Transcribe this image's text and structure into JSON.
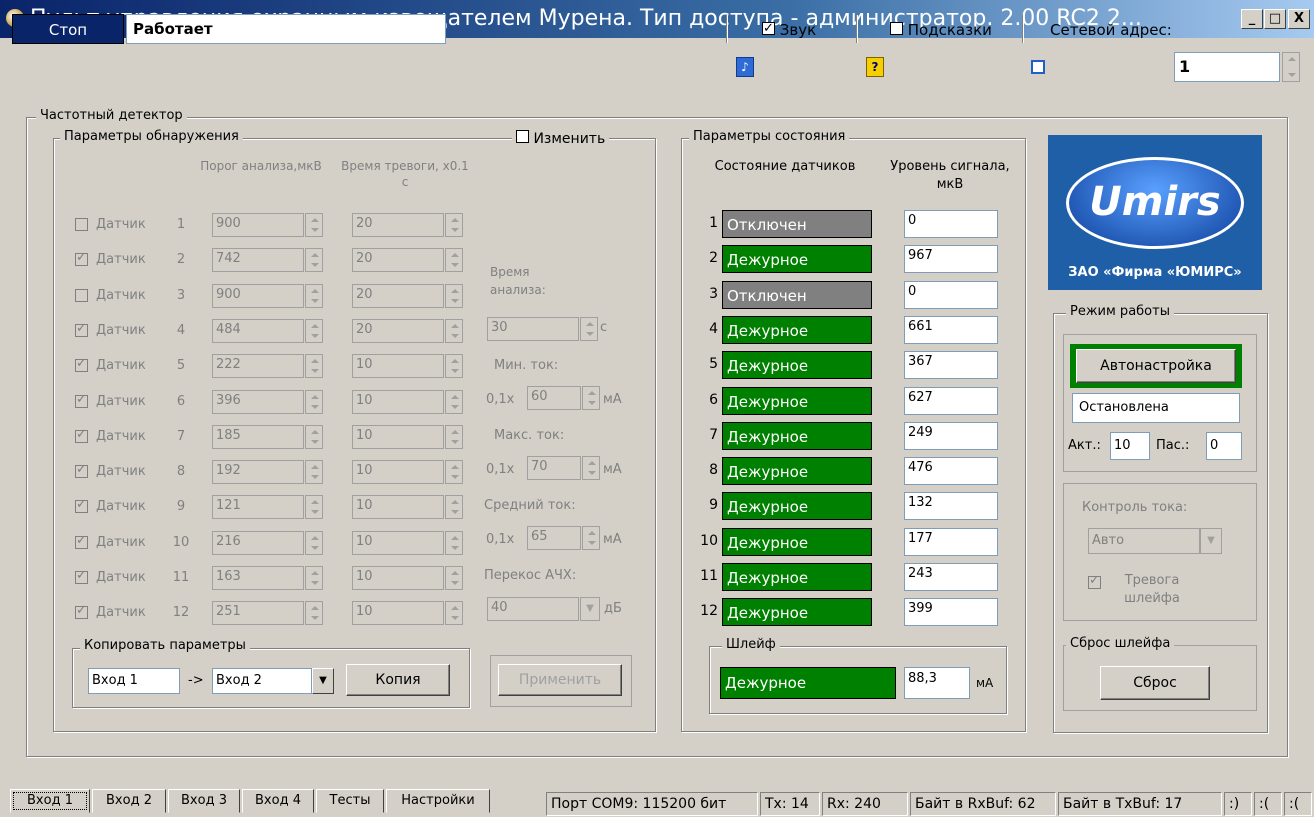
{
  "window": {
    "title": "Пульт управления охранным извещателем Мурена. Тип доступа - администратор. 2.00 RC2 2...",
    "minimize": "_",
    "maximize": "□",
    "close": "X"
  },
  "toolbar": {
    "stop_label": "Стоп",
    "status_value": "Работает",
    "sound_label": "Звук",
    "sound_checked": true,
    "hints_label": "Подсказки",
    "hints_checked": false,
    "address_label": "Сетевой адрес:",
    "address_value": "1"
  },
  "main": {
    "group_title": "Частотный детектор",
    "detect": {
      "title": "Параметры обнаружения",
      "change_label": "Изменить",
      "col_threshold": "Порог анализа,мкВ",
      "col_alarm_time": "Время тревоги, x0.1 с",
      "sensor_label": "Датчик",
      "sensors": [
        {
          "num": "1",
          "checked": false,
          "threshold": "900",
          "alarm": "20"
        },
        {
          "num": "2",
          "checked": true,
          "threshold": "742",
          "alarm": "20"
        },
        {
          "num": "3",
          "checked": false,
          "threshold": "900",
          "alarm": "20"
        },
        {
          "num": "4",
          "checked": true,
          "threshold": "484",
          "alarm": "20"
        },
        {
          "num": "5",
          "checked": true,
          "threshold": "222",
          "alarm": "10"
        },
        {
          "num": "6",
          "checked": true,
          "threshold": "396",
          "alarm": "10"
        },
        {
          "num": "7",
          "checked": true,
          "threshold": "185",
          "alarm": "10"
        },
        {
          "num": "8",
          "checked": true,
          "threshold": "192",
          "alarm": "10"
        },
        {
          "num": "9",
          "checked": true,
          "threshold": "121",
          "alarm": "10"
        },
        {
          "num": "10",
          "checked": true,
          "threshold": "216",
          "alarm": "10"
        },
        {
          "num": "11",
          "checked": true,
          "threshold": "163",
          "alarm": "10"
        },
        {
          "num": "12",
          "checked": true,
          "threshold": "251",
          "alarm": "10"
        }
      ],
      "analysis_time_label": "Время анализа:",
      "analysis_time_value": "30",
      "analysis_time_unit": "с",
      "min_current_label": "Мин. ток:",
      "min_current_prefix": "0,1x",
      "min_current_value": "60",
      "max_current_label": "Макс. ток:",
      "max_current_prefix": "0,1x",
      "max_current_value": "70",
      "avg_current_label": "Средний ток:",
      "avg_current_prefix": "0,1x",
      "avg_current_value": "65",
      "current_unit": "мА",
      "skew_label": "Перекос АЧХ:",
      "skew_value": "40",
      "skew_unit": "дБ",
      "apply_label": "Применить"
    },
    "copy": {
      "title": "Копировать параметры",
      "from": "Вход 1",
      "arrow": "->",
      "to": "Вход 2",
      "copy_label": "Копия"
    },
    "state": {
      "title": "Параметры состояния",
      "col_state": "Состояние датчиков",
      "col_level": "Уровень сигнала, мкВ",
      "rows": [
        {
          "num": "1",
          "state": "Отключен",
          "on": false,
          "level": "0"
        },
        {
          "num": "2",
          "state": "Дежурное",
          "on": true,
          "level": "967"
        },
        {
          "num": "3",
          "state": "Отключен",
          "on": false,
          "level": "0"
        },
        {
          "num": "4",
          "state": "Дежурное",
          "on": true,
          "level": "661"
        },
        {
          "num": "5",
          "state": "Дежурное",
          "on": true,
          "level": "367"
        },
        {
          "num": "6",
          "state": "Дежурное",
          "on": true,
          "level": "627"
        },
        {
          "num": "7",
          "state": "Дежурное",
          "on": true,
          "level": "249"
        },
        {
          "num": "8",
          "state": "Дежурное",
          "on": true,
          "level": "476"
        },
        {
          "num": "9",
          "state": "Дежурное",
          "on": true,
          "level": "132"
        },
        {
          "num": "10",
          "state": "Дежурное",
          "on": true,
          "level": "177"
        },
        {
          "num": "11",
          "state": "Дежурное",
          "on": true,
          "level": "243"
        },
        {
          "num": "12",
          "state": "Дежурное",
          "on": true,
          "level": "399"
        }
      ],
      "loop_title": "Шлейф",
      "loop_state": "Дежурное",
      "loop_value": "88,3",
      "loop_unit": "мА"
    },
    "logo": {
      "brand": "Umirs",
      "company": "ЗАО «Фирма «ЮМИРС»"
    },
    "mode": {
      "title": "Режим работы",
      "autotune_label": "Автонастройка",
      "autotune_status": "Остановлена",
      "act_label": "Акт.:",
      "act_value": "10",
      "pas_label": "Пас.:",
      "pas_value": "0",
      "current_control_label": "Контроль тока:",
      "current_control_value": "Авто",
      "loop_alarm_label": "Тревога шлейфа"
    },
    "reset": {
      "title": "Сброс шлейфа",
      "button_label": "Сброс"
    }
  },
  "tabs": [
    {
      "label": "Вход 1",
      "active": true
    },
    {
      "label": "Вход 2",
      "active": false
    },
    {
      "label": "Вход 3",
      "active": false
    },
    {
      "label": "Вход 4",
      "active": false
    },
    {
      "label": "Тесты",
      "active": false
    },
    {
      "label": "Настройки",
      "active": false
    }
  ],
  "statusbar": {
    "port": "Порт COM9: 115200 бит",
    "tx": "Tx: 14",
    "rx": "Rx: 240",
    "rxbuf": "Байт в RxBuf: 62",
    "txbuf": "Байт в TxBuf: 17",
    "smile1": ":)",
    "smile2": ":(",
    "smile3": ":("
  },
  "colors": {
    "title_bar": "#0a246a",
    "state_on": "#008000",
    "state_off": "#808080",
    "logo_bg": "#1f5fa8"
  }
}
